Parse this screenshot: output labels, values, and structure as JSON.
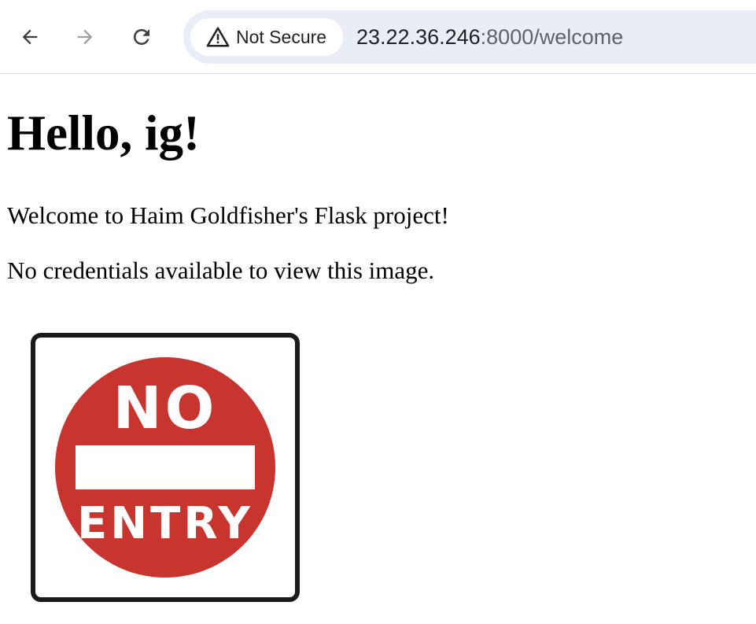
{
  "browser": {
    "security_label": "Not Secure",
    "url_host": "23.22.36.246",
    "url_path": ":8000/welcome",
    "icons": {
      "back": "arrow-left-icon",
      "forward": "arrow-right-icon",
      "reload": "reload-icon",
      "security": "warning-triangle-icon"
    }
  },
  "page": {
    "heading": "Hello, ig!",
    "welcome": "Welcome to Haim Goldfisher's Flask project!",
    "credentials_message": "No credentials available to view this image."
  },
  "image": {
    "sign_top": "NO",
    "sign_bottom": "ENTRY",
    "colors": {
      "circle": "#c8352f",
      "border": "#1a1a1a",
      "background": "#ffffff"
    }
  }
}
